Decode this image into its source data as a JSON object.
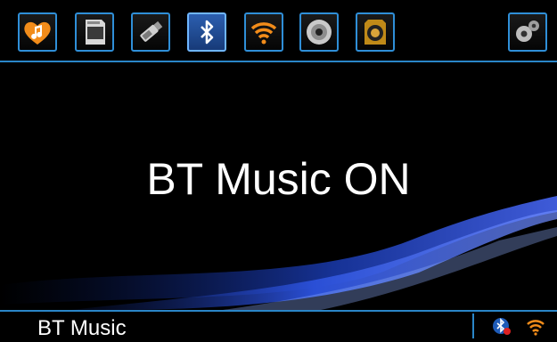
{
  "source_bar": {
    "items": [
      {
        "id": "music",
        "icon": "music-heart-icon",
        "active": false
      },
      {
        "id": "sd",
        "icon": "sd-card-icon",
        "active": false
      },
      {
        "id": "usb",
        "icon": "usb-stick-icon",
        "active": false
      },
      {
        "id": "bluetooth",
        "icon": "bluetooth-icon",
        "active": true
      },
      {
        "id": "wifi",
        "icon": "wifi-icon",
        "active": false
      },
      {
        "id": "disc",
        "icon": "disc-icon",
        "active": false
      },
      {
        "id": "speaker",
        "icon": "speaker-icon",
        "active": false
      }
    ],
    "settings_icon": "gears-icon"
  },
  "main": {
    "headline": "BT Music ON"
  },
  "status_bar": {
    "source_label": "BT Music",
    "icons": [
      "bluetooth-status-icon",
      "wifi-status-icon"
    ]
  },
  "colors": {
    "accent": "#2a86c8",
    "background": "#000000",
    "icon_orange": "#f28c1a",
    "active_blue": "#2c5fb0"
  }
}
